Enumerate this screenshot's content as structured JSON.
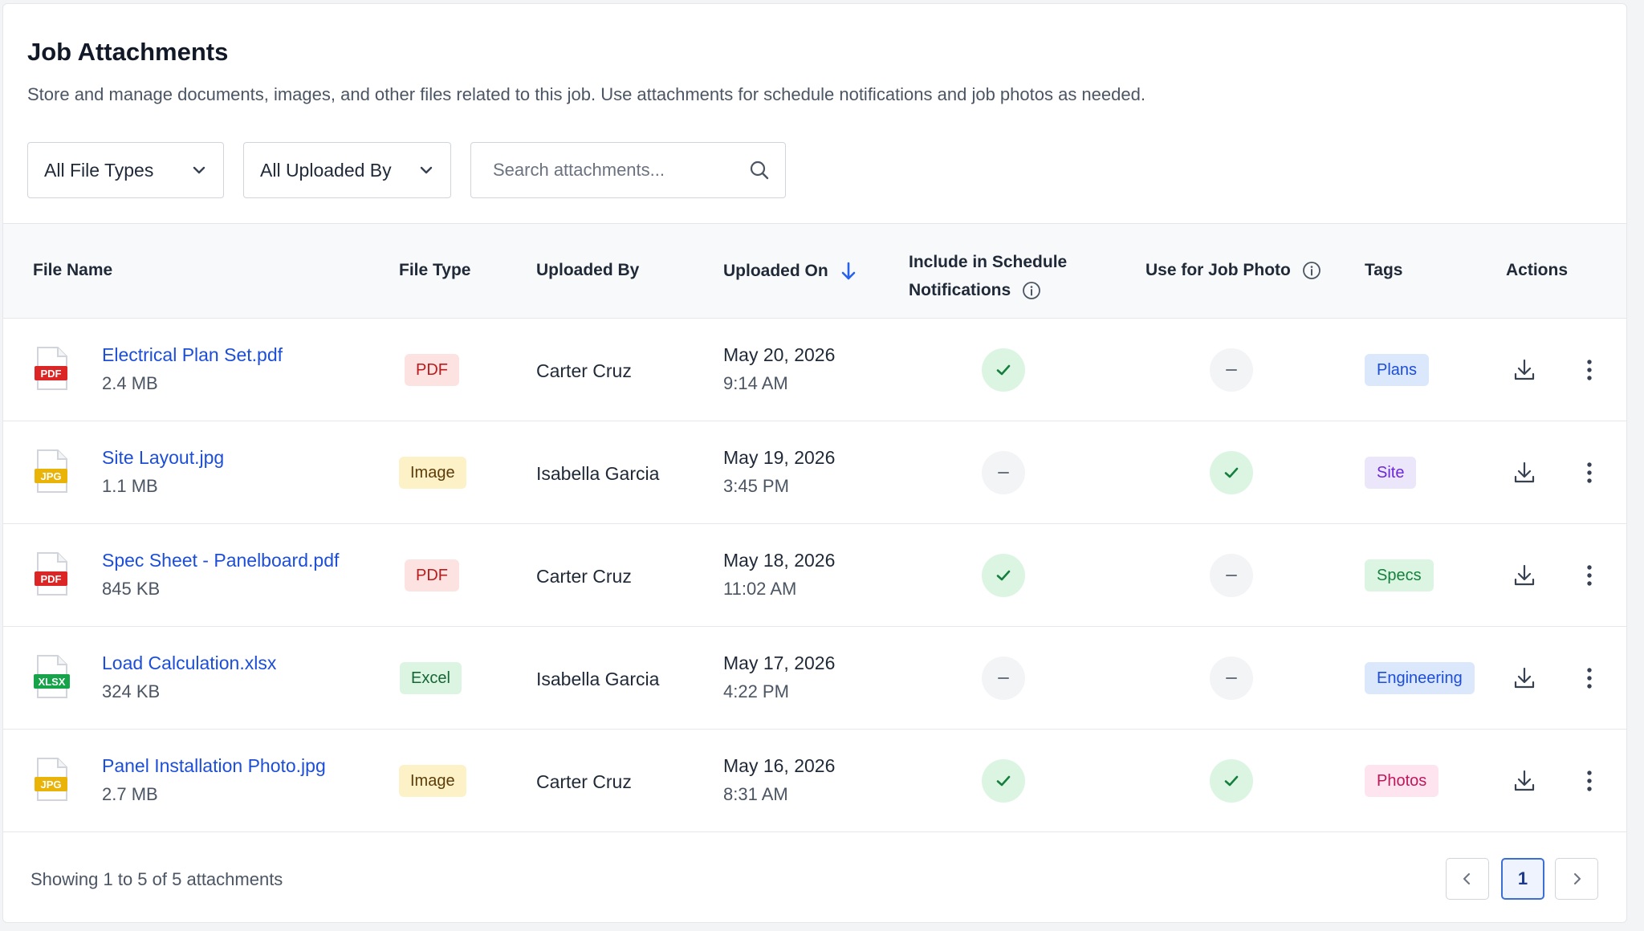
{
  "page": {
    "title": "Job Attachments",
    "description": "Store and manage documents, images, and other files related to this job. Use attachments for schedule notifications and job photos as needed."
  },
  "filters": {
    "file_type": "All File Types",
    "uploaded_by": "All Uploaded By",
    "search_placeholder": "Search attachments..."
  },
  "table": {
    "headers": {
      "file_name": "File Name",
      "file_type": "File Type",
      "uploaded_by": "Uploaded By",
      "uploaded_on": "Uploaded On",
      "schedule_line1": "Include in Schedule",
      "schedule_line2": "Notifications",
      "job_photo": "Use for Job Photo",
      "tags": "Tags",
      "actions": "Actions"
    },
    "rows": [
      {
        "name": "Electrical Plan Set.pdf",
        "size": "2.4 MB",
        "icon_label": "PDF",
        "type": "PDF",
        "uploaded_by": "Carter Cruz",
        "date": "May 20, 2026",
        "time": "9:14 AM",
        "schedule": true,
        "job_photo": false,
        "tag": "Plans"
      },
      {
        "name": "Site Layout.jpg",
        "size": "1.1 MB",
        "icon_label": "JPG",
        "type": "Image",
        "uploaded_by": "Isabella Garcia",
        "date": "May 19, 2026",
        "time": "3:45 PM",
        "schedule": false,
        "job_photo": true,
        "tag": "Site"
      },
      {
        "name": "Spec Sheet - Panelboard.pdf",
        "size": "845 KB",
        "icon_label": "PDF",
        "type": "PDF",
        "uploaded_by": "Carter Cruz",
        "date": "May 18, 2026",
        "time": "11:02 AM",
        "schedule": true,
        "job_photo": false,
        "tag": "Specs"
      },
      {
        "name": "Load Calculation.xlsx",
        "size": "324 KB",
        "icon_label": "XLSX",
        "type": "Excel",
        "uploaded_by": "Isabella Garcia",
        "date": "May 17, 2026",
        "time": "4:22 PM",
        "schedule": false,
        "job_photo": false,
        "tag": "Engineering"
      },
      {
        "name": "Panel Installation Photo.jpg",
        "size": "2.7 MB",
        "icon_label": "JPG",
        "type": "Image",
        "uploaded_by": "Carter Cruz",
        "date": "May 16, 2026",
        "time": "8:31 AM",
        "schedule": true,
        "job_photo": true,
        "tag": "Photos"
      }
    ]
  },
  "footer": {
    "summary": "Showing 1 to 5 of 5 attachments",
    "current_page": "1"
  },
  "colors": {
    "link": "#1d4ed8",
    "pdf_icon": "#dc2626",
    "jpg_icon": "#eab308",
    "xlsx_icon": "#16a34a",
    "check": "#15803d",
    "accent": "#3b6fd6"
  },
  "icons": {
    "dropdown": "chevron-down-icon",
    "search": "search-icon",
    "sort": "arrow-down-icon",
    "info": "info-icon",
    "download": "download-icon",
    "more": "more-vertical-icon",
    "check": "check-icon",
    "none": "dash-icon",
    "prev": "chevron-left-icon",
    "next": "chevron-right-icon"
  }
}
